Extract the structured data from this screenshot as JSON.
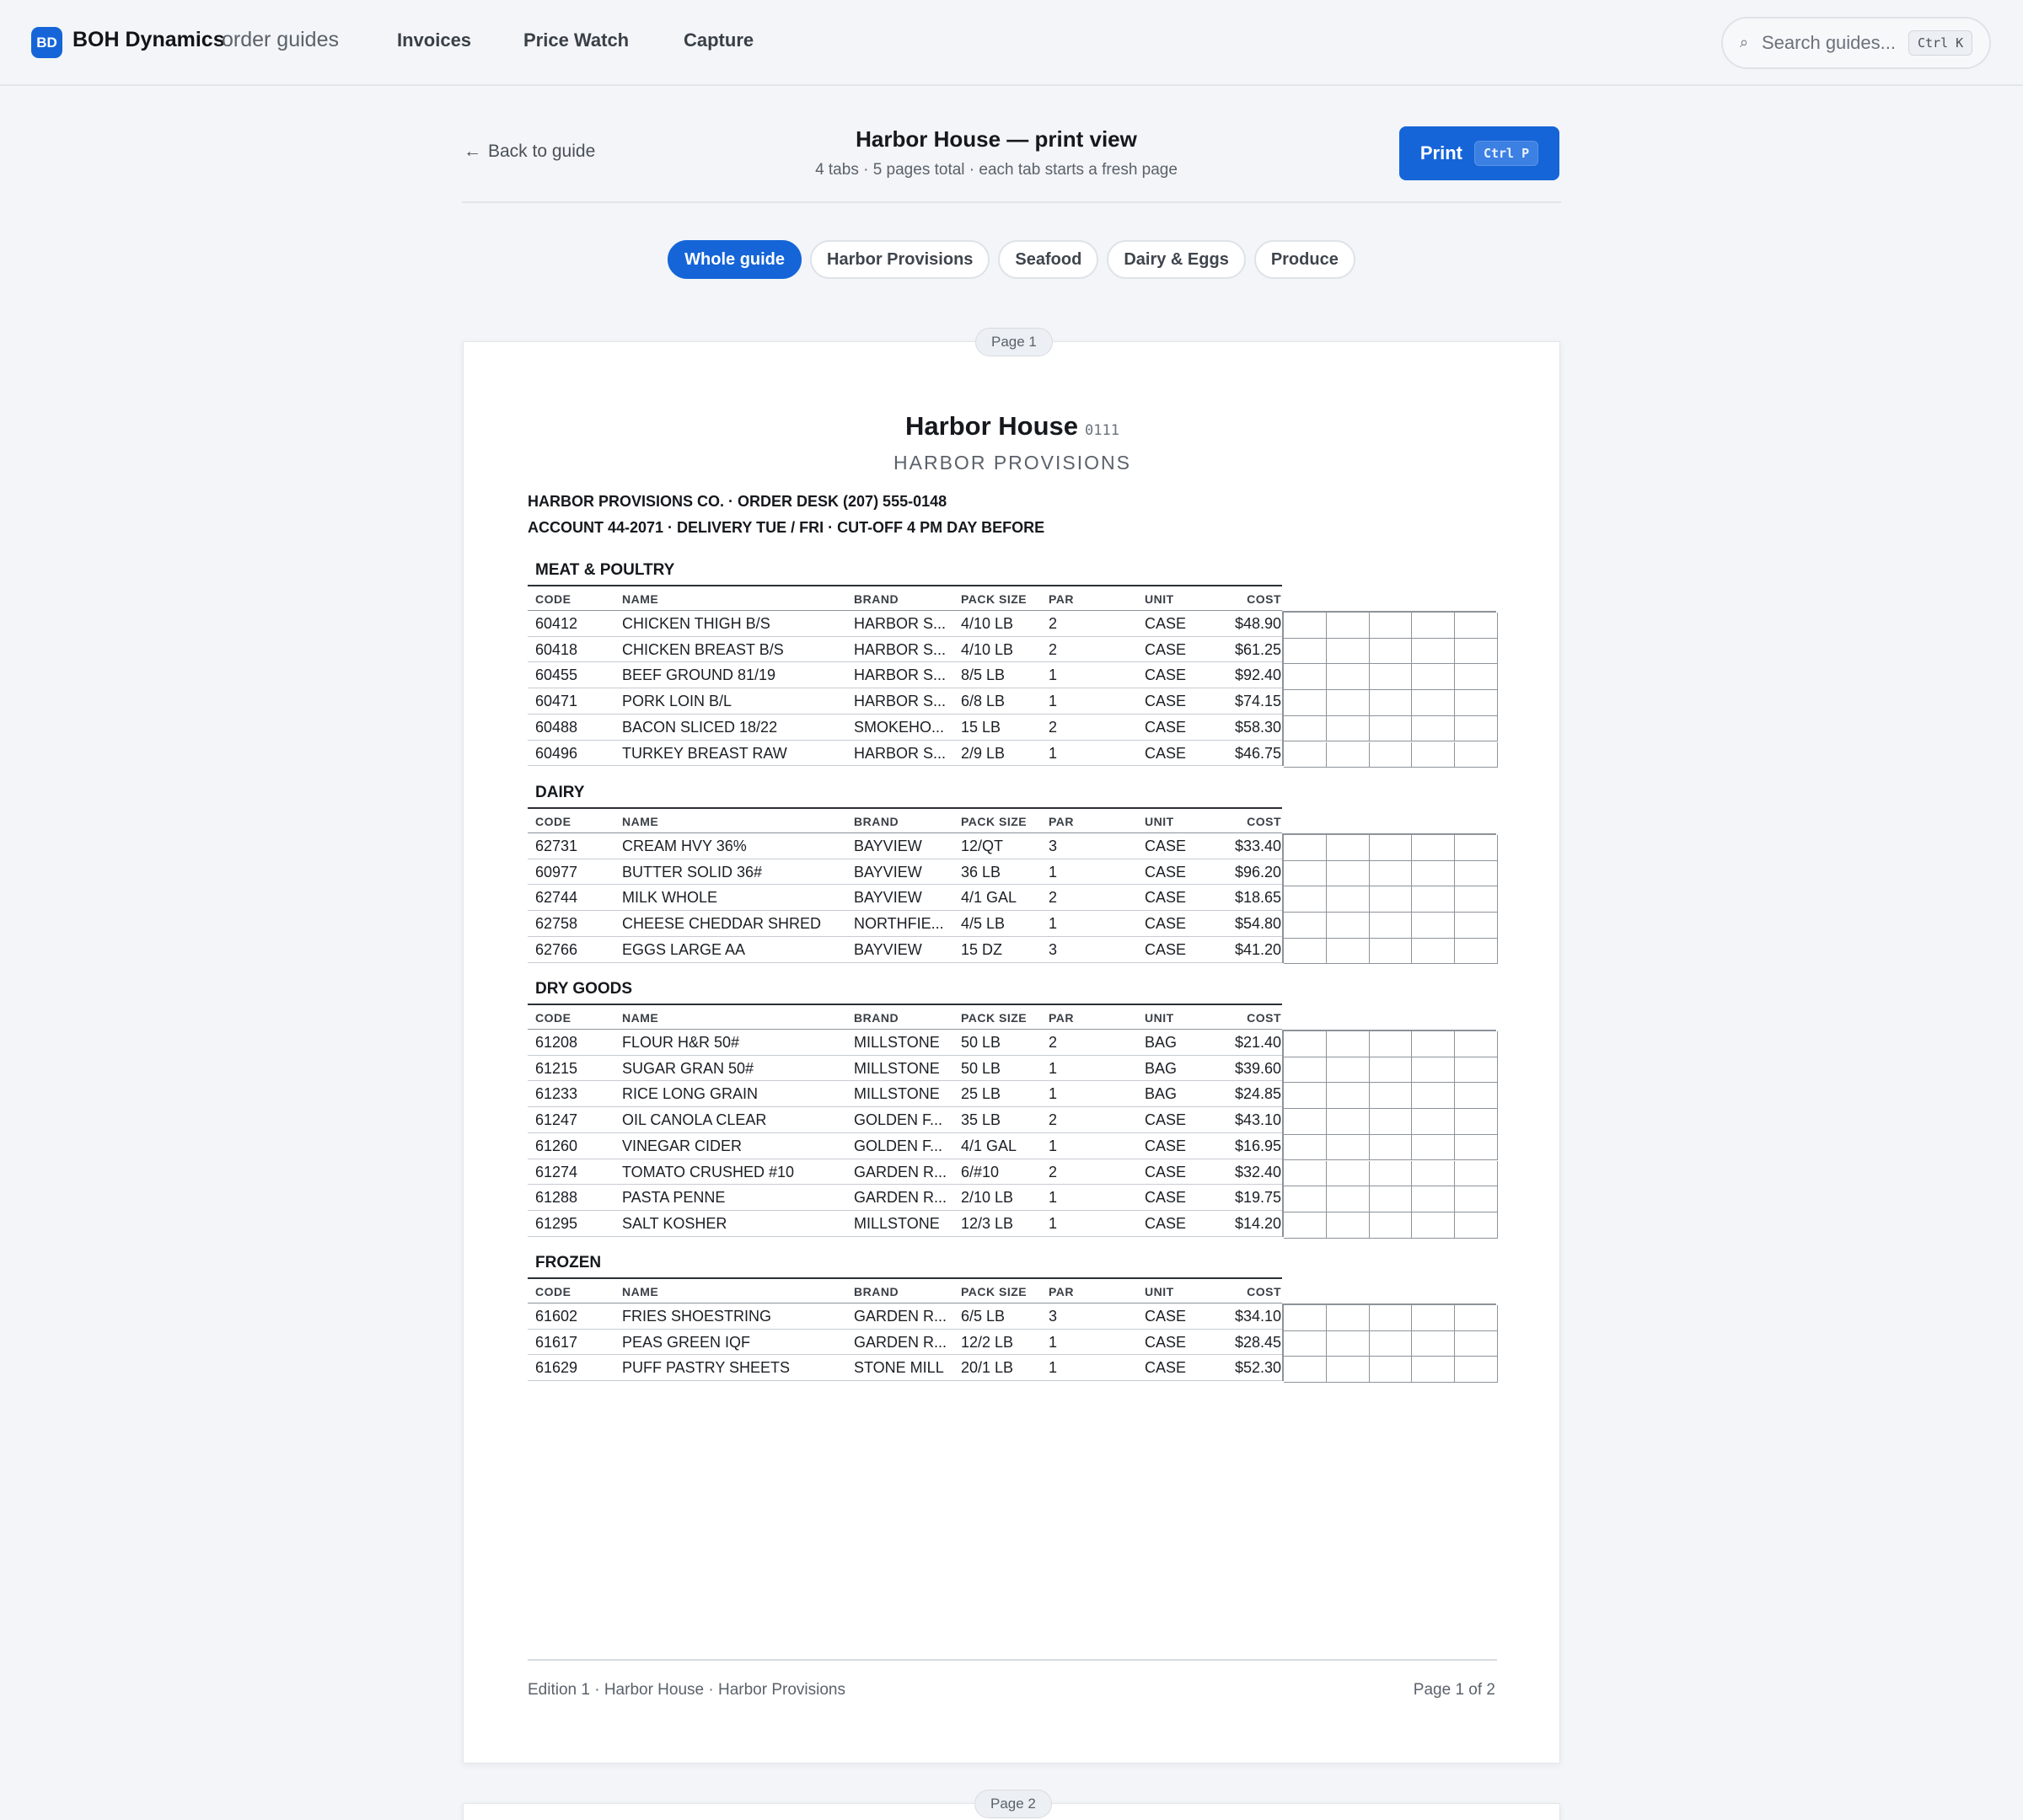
{
  "app": {
    "badge": "BD",
    "name": "BOH Dynamics",
    "subtitle": "order guides",
    "nav": [
      "Invoices",
      "Price Watch",
      "Capture"
    ],
    "search": {
      "placeholder": "Search guides...",
      "shortcut": "Ctrl K"
    }
  },
  "header": {
    "back_label": "Back to guide",
    "title": "Harbor House — print view",
    "subtitle": "4 tabs · 5 pages total · each tab starts a fresh page",
    "print_label": "Print",
    "print_shortcut": "Ctrl P"
  },
  "tabs": [
    {
      "label": "Whole guide",
      "active": true
    },
    {
      "label": "Harbor Provisions",
      "active": false
    },
    {
      "label": "Seafood",
      "active": false
    },
    {
      "label": "Dairy & Eggs",
      "active": false
    },
    {
      "label": "Produce",
      "active": false
    }
  ],
  "pages": [
    {
      "pill": "Page 1",
      "title": "Harbor House",
      "title_number": "0111",
      "vendor": "HARBOR PROVISIONS",
      "vendor_lines": [
        "HARBOR PROVISIONS CO. · ORDER DESK (207) 555-0148",
        "ACCOUNT 44-2071 · DELIVERY TUE / FRI · CUT-OFF 4 PM DAY BEFORE"
      ],
      "columns": [
        "CODE",
        "NAME",
        "BRAND",
        "PACK SIZE",
        "PAR",
        "UNIT",
        "COST"
      ],
      "sections": [
        {
          "title": "MEAT & POULTRY",
          "rows": [
            [
              "60412",
              "CHICKEN THIGH B/S",
              "HARBOR S...",
              "4/10 LB",
              "2",
              "CASE",
              "$48.90"
            ],
            [
              "60418",
              "CHICKEN BREAST B/S",
              "HARBOR S...",
              "4/10 LB",
              "2",
              "CASE",
              "$61.25"
            ],
            [
              "60455",
              "BEEF GROUND 81/19",
              "HARBOR S...",
              "8/5 LB",
              "1",
              "CASE",
              "$92.40"
            ],
            [
              "60471",
              "PORK LOIN B/L",
              "HARBOR S...",
              "6/8 LB",
              "1",
              "CASE",
              "$74.15"
            ],
            [
              "60488",
              "BACON SLICED 18/22",
              "SMOKEHO...",
              "15 LB",
              "2",
              "CASE",
              "$58.30"
            ],
            [
              "60496",
              "TURKEY BREAST RAW",
              "HARBOR S...",
              "2/9 LB",
              "1",
              "CASE",
              "$46.75"
            ]
          ]
        },
        {
          "title": "DAIRY",
          "rows": [
            [
              "62731",
              "CREAM HVY 36%",
              "BAYVIEW",
              "12/QT",
              "3",
              "CASE",
              "$33.40"
            ],
            [
              "60977",
              "BUTTER SOLID 36#",
              "BAYVIEW",
              "36 LB",
              "1",
              "CASE",
              "$96.20"
            ],
            [
              "62744",
              "MILK WHOLE",
              "BAYVIEW",
              "4/1 GAL",
              "2",
              "CASE",
              "$18.65"
            ],
            [
              "62758",
              "CHEESE CHEDDAR SHRED",
              "NORTHFIE...",
              "4/5 LB",
              "1",
              "CASE",
              "$54.80"
            ],
            [
              "62766",
              "EGGS LARGE AA",
              "BAYVIEW",
              "15 DZ",
              "3",
              "CASE",
              "$41.20"
            ]
          ]
        },
        {
          "title": "DRY GOODS",
          "rows": [
            [
              "61208",
              "FLOUR H&R 50#",
              "MILLSTONE",
              "50 LB",
              "2",
              "BAG",
              "$21.40"
            ],
            [
              "61215",
              "SUGAR GRAN 50#",
              "MILLSTONE",
              "50 LB",
              "1",
              "BAG",
              "$39.60"
            ],
            [
              "61233",
              "RICE LONG GRAIN",
              "MILLSTONE",
              "25 LB",
              "1",
              "BAG",
              "$24.85"
            ],
            [
              "61247",
              "OIL CANOLA CLEAR",
              "GOLDEN F...",
              "35 LB",
              "2",
              "CASE",
              "$43.10"
            ],
            [
              "61260",
              "VINEGAR CIDER",
              "GOLDEN F...",
              "4/1 GAL",
              "1",
              "CASE",
              "$16.95"
            ],
            [
              "61274",
              "TOMATO CRUSHED #10",
              "GARDEN R...",
              "6/#10",
              "2",
              "CASE",
              "$32.40"
            ],
            [
              "61288",
              "PASTA PENNE",
              "GARDEN R...",
              "2/10 LB",
              "1",
              "CASE",
              "$19.75"
            ],
            [
              "61295",
              "SALT KOSHER",
              "MILLSTONE",
              "12/3 LB",
              "1",
              "CASE",
              "$14.20"
            ]
          ]
        },
        {
          "title": "FROZEN",
          "rows": [
            [
              "61602",
              "FRIES SHOESTRING",
              "GARDEN R...",
              "6/5 LB",
              "3",
              "CASE",
              "$34.10"
            ],
            [
              "61617",
              "PEAS GREEN IQF",
              "GARDEN R...",
              "12/2 LB",
              "1",
              "CASE",
              "$28.45"
            ],
            [
              "61629",
              "PUFF PASTRY SHEETS",
              "STONE MILL",
              "20/1 LB",
              "1",
              "CASE",
              "$52.30"
            ]
          ]
        }
      ],
      "footer_left": "Edition 1 · Harbor House · Harbor Provisions",
      "footer_right": "Page 1 of 2"
    },
    {
      "pill": "Page 2"
    }
  ],
  "colors": {
    "accent": "#1565d8"
  }
}
